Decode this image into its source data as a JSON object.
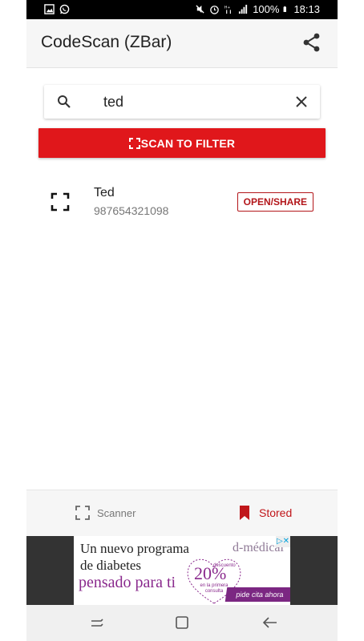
{
  "status_bar": {
    "battery": "100%",
    "time": "18:13",
    "icons": [
      "image-icon",
      "whatsapp-icon",
      "mute-icon",
      "alarm-icon",
      "hd-icon",
      "signal-icon",
      "battery-icon"
    ]
  },
  "app_bar": {
    "title": "CodeScan (ZBar)",
    "share_icon": "share-icon"
  },
  "search": {
    "value": "ted",
    "search_icon": "search-icon",
    "clear_icon": "close-icon"
  },
  "scan_button": {
    "label": "SCAN TO FILTER",
    "icon": "scan-frame-icon"
  },
  "items": [
    {
      "name": "Ted",
      "code": "987654321098",
      "action_label": "OPEN/SHARE",
      "icon": "barcode-scan-icon"
    }
  ],
  "bottom_nav": {
    "scanner_label": "Scanner",
    "stored_label": "Stored",
    "active": "Stored"
  },
  "ad": {
    "line1": "Un nuevo programa",
    "line2": "de diabetes",
    "line3": "pensado para ti",
    "brand": "d-médical",
    "percent": "20%",
    "percent_label": "descuento",
    "percent_small": "en la primera consulta",
    "cta": "pide cita ahora",
    "adchoices": "▷✕"
  },
  "colors": {
    "accent": "#e0171b",
    "accent_dark": "#b3161a",
    "ad_purple": "#8a2a8d"
  }
}
